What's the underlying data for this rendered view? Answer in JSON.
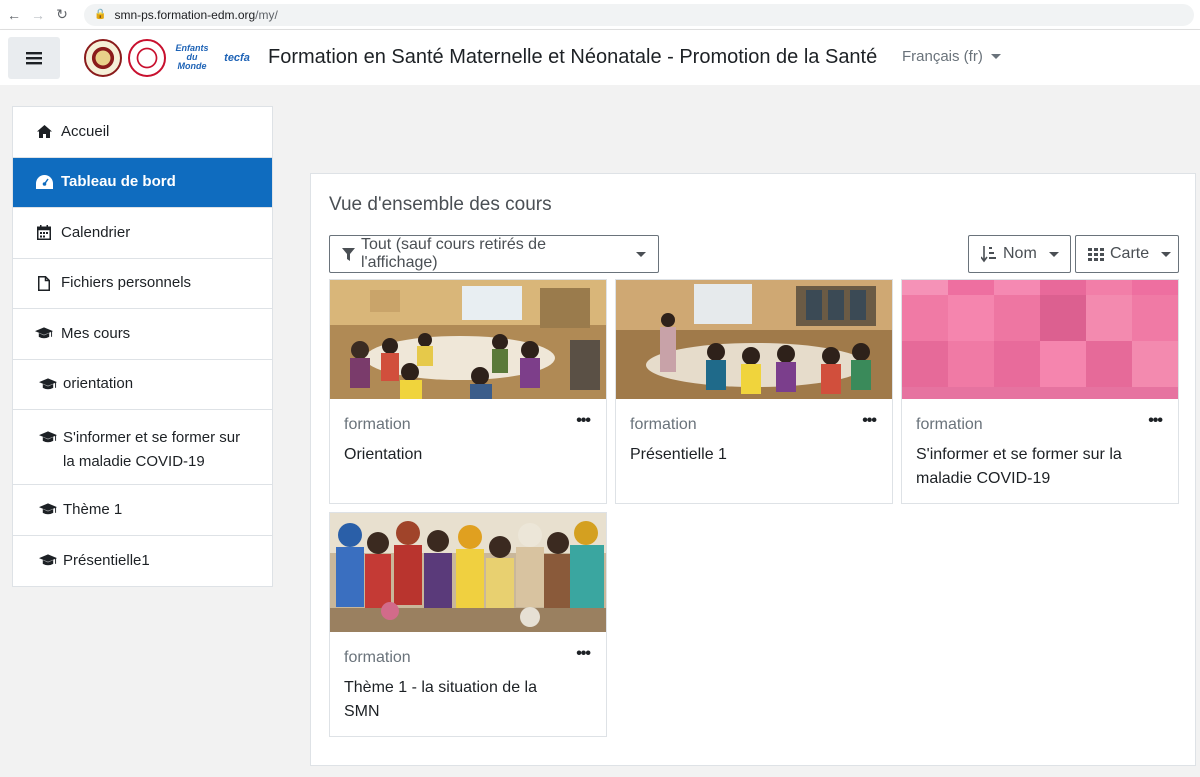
{
  "browser": {
    "url_host": "smn-ps.formation-edm.org",
    "url_path": "/my/"
  },
  "navbar": {
    "title": "Formation en Santé Maternelle et Néonatale - Promotion de la Santé",
    "language": "Français (fr)",
    "logo3_text": "Enfants du Monde",
    "logo4_text": "tecfa"
  },
  "sidebar": {
    "items": [
      {
        "label": "Accueil",
        "icon": "home-icon"
      },
      {
        "label": "Tableau de bord",
        "icon": "dashboard-icon",
        "active": true
      },
      {
        "label": "Calendrier",
        "icon": "calendar-icon"
      },
      {
        "label": "Fichiers personnels",
        "icon": "file-icon"
      },
      {
        "label": "Mes cours",
        "icon": "graduation-cap-icon"
      },
      {
        "label": "orientation",
        "icon": "graduation-cap-icon"
      },
      {
        "label": "S'informer et se former sur la maladie COVID-19",
        "icon": "graduation-cap-icon"
      },
      {
        "label": "Thème 1",
        "icon": "graduation-cap-icon"
      },
      {
        "label": "Présentielle1",
        "icon": "graduation-cap-icon"
      }
    ]
  },
  "overview": {
    "title": "Vue d'ensemble des cours",
    "filter_label": "Tout (sauf cours retirés de l'affichage)",
    "sort_label": "Nom",
    "view_label": "Carte",
    "more_label": "•••",
    "courses": [
      {
        "category": "formation",
        "name": "Orientation"
      },
      {
        "category": "formation",
        "name": "Présentielle 1"
      },
      {
        "category": "formation",
        "name": "S'informer et se former sur la maladie COVID-19"
      },
      {
        "category": "formation",
        "name": "Thème 1 - la situation de la SMN"
      }
    ]
  },
  "colors": {
    "primary": "#0f6cbf",
    "pattern_pink": "#f27ea8"
  }
}
